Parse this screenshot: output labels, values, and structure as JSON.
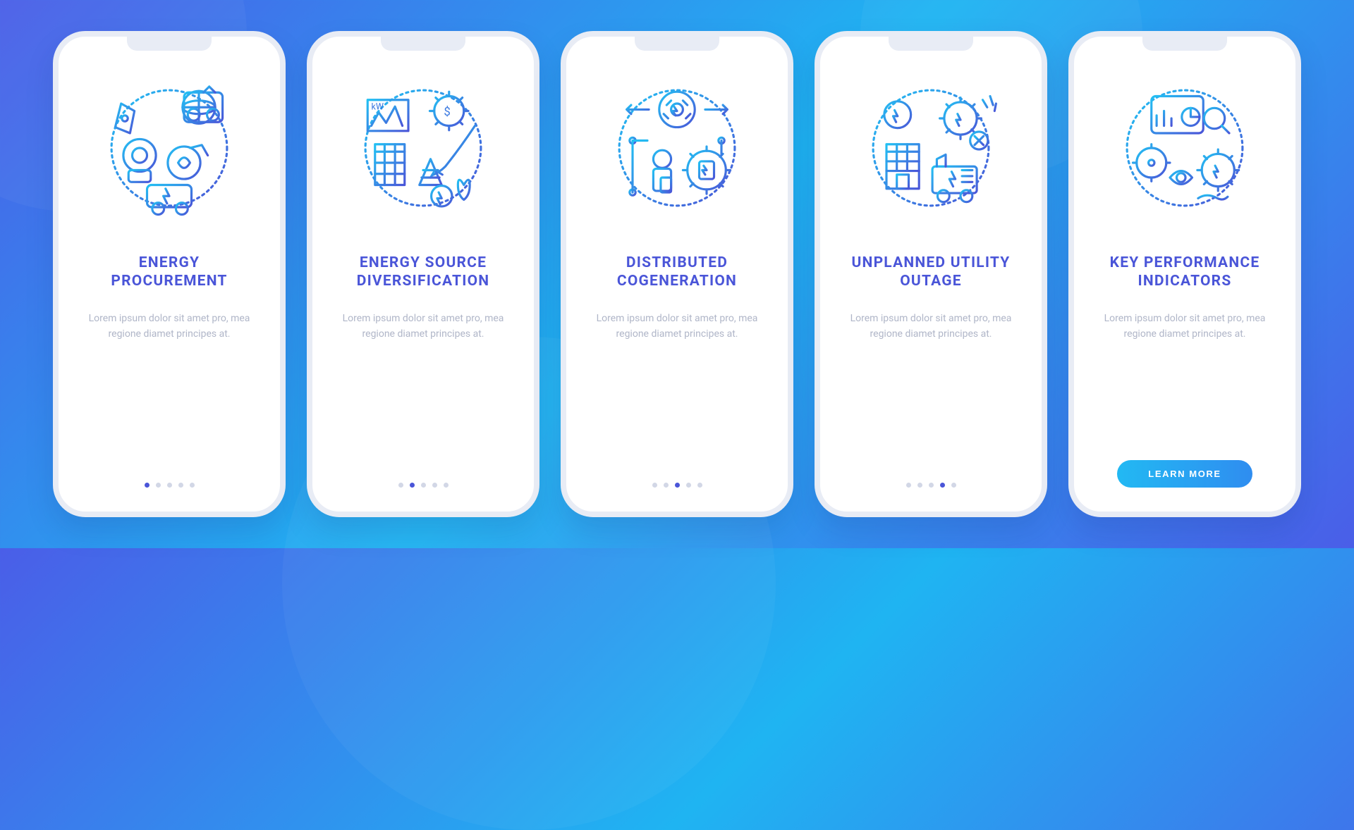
{
  "colors": {
    "title": "#4a55d8",
    "desc": "#b0b6c8",
    "dotActive": "#4a55d8",
    "dotInactive": "#d2d7e6",
    "ctaGradientStart": "#22b9f3",
    "ctaGradientEnd": "#2f8df0",
    "bgStart": "#4a5ee8",
    "bgEnd": "#1fb4f2"
  },
  "screens": [
    {
      "icon": "energy-procurement-icon",
      "title": "ENERGY PROCUREMENT",
      "desc": "Lorem ipsum dolor sit amet pro, mea regione diamet principes at.",
      "activeDot": 0,
      "showCta": false
    },
    {
      "icon": "energy-diversification-icon",
      "title": "ENERGY SOURCE DIVERSIFICATION",
      "desc": "Lorem ipsum dolor sit amet pro, mea regione diamet principes at.",
      "activeDot": 1,
      "showCta": false
    },
    {
      "icon": "distributed-cogeneration-icon",
      "title": "DISTRIBUTED COGENERATION",
      "desc": "Lorem ipsum dolor sit amet pro, mea regione diamet principes at.",
      "activeDot": 2,
      "showCta": false
    },
    {
      "icon": "unplanned-outage-icon",
      "title": "UNPLANNED UTILITY OUTAGE",
      "desc": "Lorem ipsum dolor sit amet pro, mea regione diamet principes at.",
      "activeDot": 3,
      "showCta": false
    },
    {
      "icon": "kpi-icon",
      "title": "KEY PERFORMANCE INDICATORS",
      "desc": "Lorem ipsum dolor sit amet pro, mea regione diamet principes at.",
      "activeDot": 4,
      "showCta": true
    }
  ],
  "dotsCount": 5,
  "cta_label": "LEARN MORE"
}
